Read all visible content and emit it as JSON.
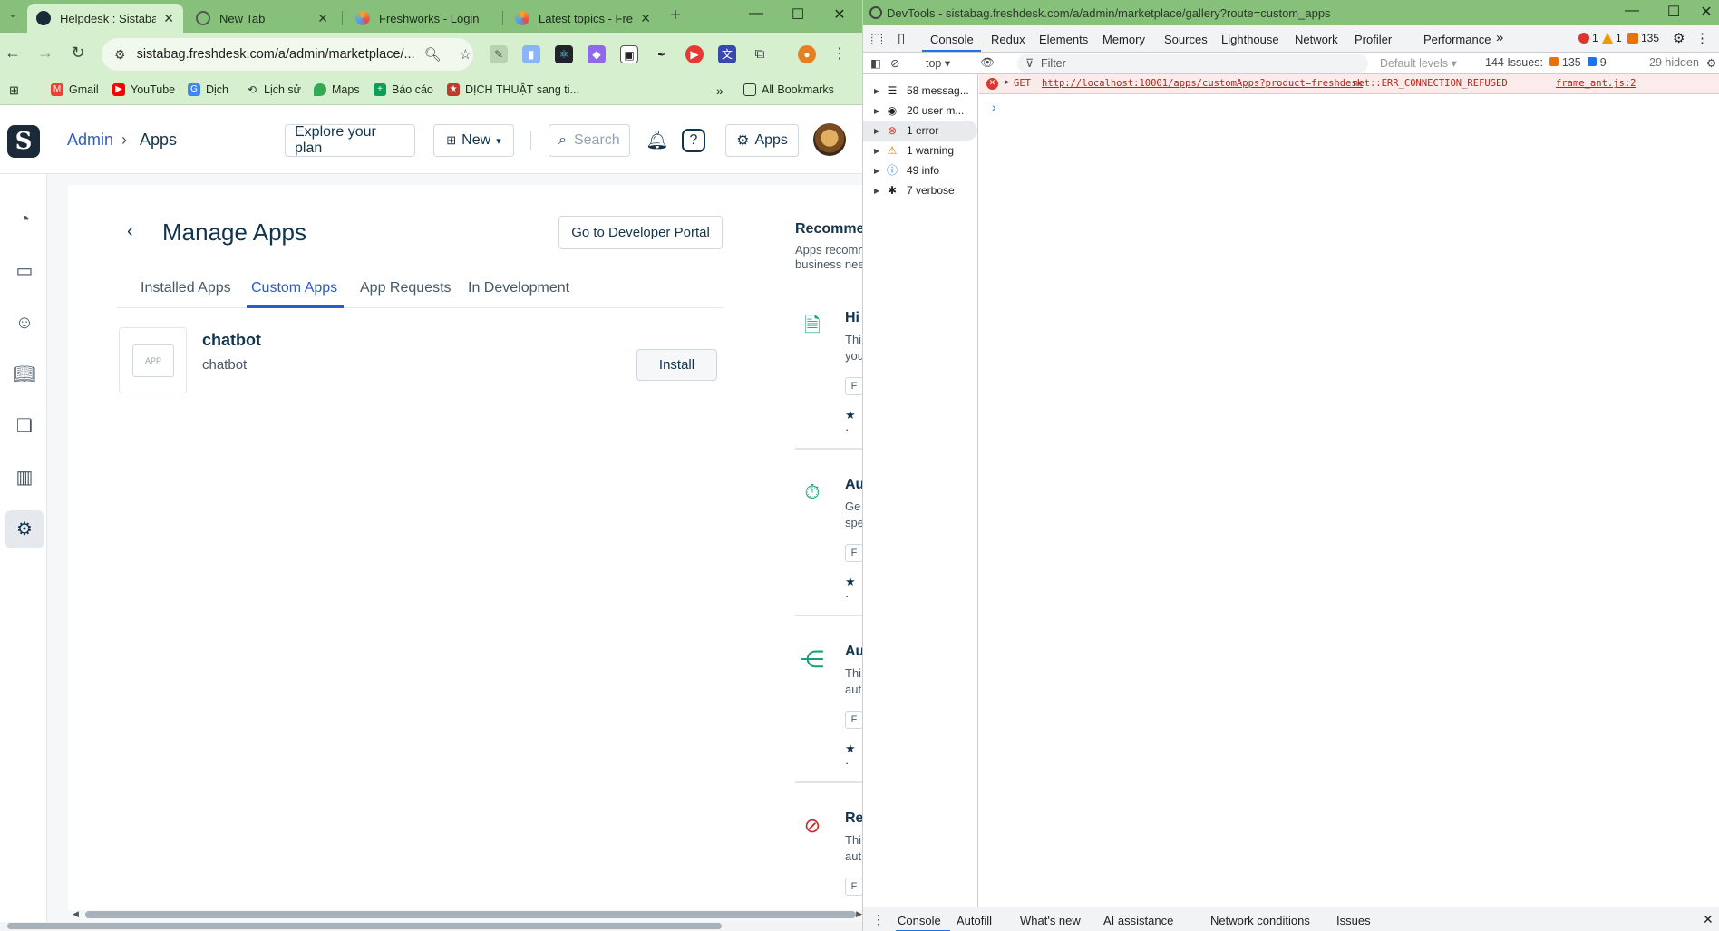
{
  "browser": {
    "tabs": [
      {
        "title": "Helpdesk : Sistabag",
        "active": true
      },
      {
        "title": "New Tab",
        "active": false
      },
      {
        "title": "Freshworks - Login",
        "active": false
      },
      {
        "title": "Latest topics - Fresh",
        "active": false
      }
    ],
    "new_tab_label": "+",
    "url": "sistabag.freshdesk.com/a/admin/marketplace/...",
    "bookmarks": [
      {
        "label": "Gmail"
      },
      {
        "label": "YouTube"
      },
      {
        "label": "Dịch"
      },
      {
        "label": "Lịch sử"
      },
      {
        "label": "Maps"
      },
      {
        "label": "Báo cáo"
      },
      {
        "label": "DỊCH THUẬT sang ti..."
      }
    ],
    "all_bookmarks_label": "All Bookmarks"
  },
  "header": {
    "logo_letter": "S",
    "breadcrumb_admin": "Admin",
    "breadcrumb_sep": "›",
    "breadcrumb_current": "Apps",
    "explore_plan": "Explore your plan",
    "new_label": "New",
    "search_placeholder": "Search",
    "apps_label": "Apps"
  },
  "main": {
    "title": "Manage Apps",
    "dev_portal_button": "Go to Developer Portal",
    "tabs": [
      {
        "label": "Installed Apps",
        "active": false
      },
      {
        "label": "Custom Apps",
        "active": true
      },
      {
        "label": "App Requests",
        "active": false
      },
      {
        "label": "In Development",
        "active": false
      }
    ],
    "app": {
      "icon_text": "APP",
      "name": "chatbot",
      "description": "chatbot",
      "install_button": "Install"
    }
  },
  "recommended": {
    "title": "Recommen",
    "subtitle_line1": "Apps recomm",
    "subtitle_line2": "business nee",
    "items": [
      {
        "name": "Hi",
        "desc1": "Thi",
        "desc2": "you",
        "tag": "F",
        "star": "★ ·"
      },
      {
        "name": "Au",
        "desc1": "Ge",
        "desc2": "spe",
        "tag": "F",
        "star": "★ ·"
      },
      {
        "name": "Au",
        "desc1": "Thi",
        "desc2": "aut",
        "tag": "F",
        "star": "★ ·"
      },
      {
        "name": "Re",
        "desc1": "Thi",
        "desc2": "aut",
        "tag": "F",
        "star": ""
      }
    ]
  },
  "devtools": {
    "title": "DevTools - sistabag.freshdesk.com/a/admin/marketplace/gallery?route=custom_apps",
    "tabs": [
      "Console",
      "Redux",
      "Elements",
      "Memory",
      "Sources",
      "Lighthouse",
      "Network",
      "Profiler",
      "Performance"
    ],
    "more_tabs": "»",
    "error_count": "1",
    "warning_count": "1",
    "issues_count": "135",
    "context": "top",
    "filter_placeholder": "Filter",
    "levels": "Default levels",
    "issues_label": "144 Issues:",
    "issues_errors": "135",
    "issues_info": "9",
    "hidden_label": "29 hidden",
    "sidebar": [
      {
        "label": "58 messag...",
        "icon": "list-icon"
      },
      {
        "label": "20 user m...",
        "icon": "user-icon"
      },
      {
        "label": "1 error",
        "icon": "error-icon"
      },
      {
        "label": "1 warning",
        "icon": "warning-icon"
      },
      {
        "label": "49 info",
        "icon": "info-icon"
      },
      {
        "label": "7 verbose",
        "icon": "bug-icon"
      }
    ],
    "error_entry": {
      "method": "GET",
      "url": "http://localhost:10001/apps/customApps?product=freshdesk",
      "message": "net::ERR_CONNECTION_REFUSED",
      "source": "frame_ant.js:2"
    },
    "prompt": "›",
    "drawer_tabs": [
      "Console",
      "Autofill",
      "What's new",
      "AI assistance",
      "Network conditions",
      "Issues"
    ]
  },
  "colors": {
    "chrome_green": "#86c07b",
    "freshdesk_blue": "#2c5cc5",
    "error_red": "#dc362e"
  }
}
